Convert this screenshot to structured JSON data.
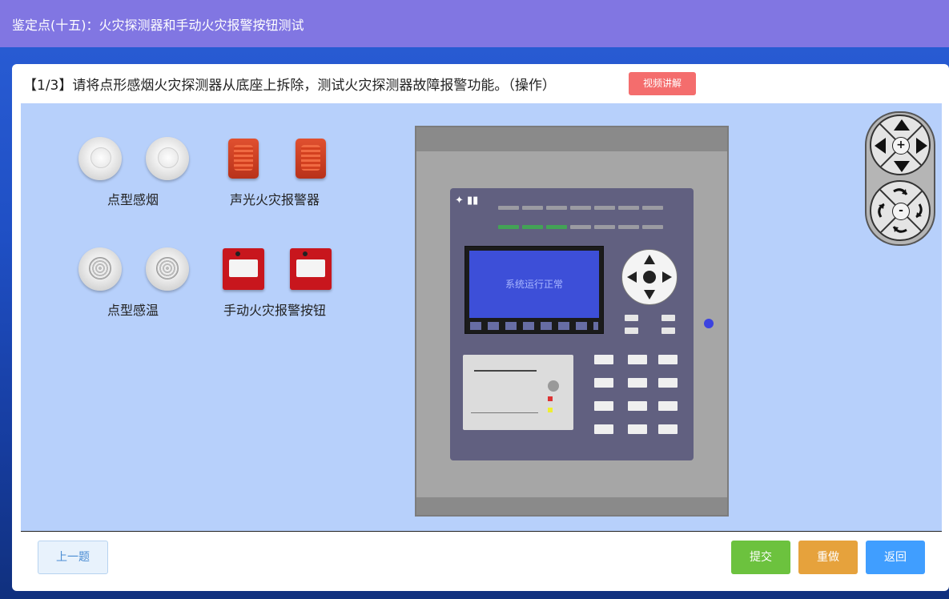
{
  "header": {
    "title": "鉴定点(十五)：火灾探测器和手动火灾报警按钮测试"
  },
  "question": {
    "text": "【1/3】请将点形感烟火灾探测器从底座上拆除，测试火灾探测器故障报警功能。（操作）",
    "video_button": "视频讲解"
  },
  "devices": {
    "smoke_label": "点型感烟",
    "alarm_label": "声光火灾报警器",
    "heat_label": "点型感温",
    "manual_label": "手动火灾报警按钮"
  },
  "panel": {
    "screen_text": "系统运行正常"
  },
  "controls": {
    "zoom_in": "+",
    "zoom_out": "-"
  },
  "footer": {
    "prev_label": "上一题",
    "submit_label": "提交",
    "redo_label": "重做",
    "back_label": "返回"
  },
  "colors": {
    "topbar": "#8176e2",
    "stage": "#b7d0fb",
    "submit": "#6cc23e",
    "redo": "#e6a23c",
    "back": "#409eff",
    "video": "#f46d6d"
  }
}
